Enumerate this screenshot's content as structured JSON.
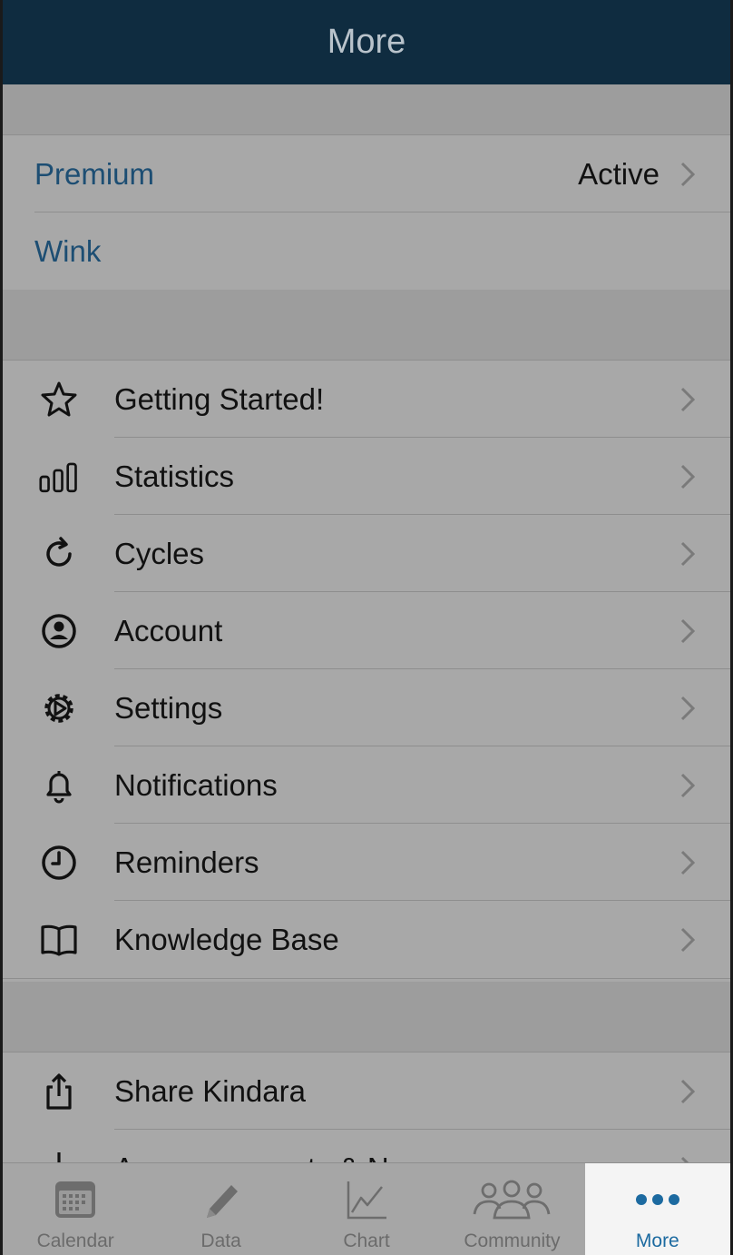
{
  "navbar": {
    "title": "More"
  },
  "premium_group": {
    "items": [
      {
        "label": "Premium",
        "value": "Active"
      },
      {
        "label": "Wink"
      }
    ]
  },
  "menu": {
    "items": [
      {
        "label": "Getting Started!",
        "icon": "star-icon"
      },
      {
        "label": "Statistics",
        "icon": "bar-chart-icon"
      },
      {
        "label": "Cycles",
        "icon": "refresh-icon"
      },
      {
        "label": "Account",
        "icon": "user-circle-icon"
      },
      {
        "label": "Settings",
        "icon": "gear-icon"
      },
      {
        "label": "Notifications",
        "icon": "bell-icon"
      },
      {
        "label": "Reminders",
        "icon": "clock-icon"
      },
      {
        "label": "Knowledge Base",
        "icon": "book-icon"
      }
    ]
  },
  "share_group": {
    "items": [
      {
        "label": "Share Kindara",
        "icon": "share-icon"
      },
      {
        "label": "Announcements & News",
        "icon": "download-icon"
      }
    ]
  },
  "tabbar": {
    "tabs": [
      {
        "label": "Calendar",
        "icon": "calendar-icon"
      },
      {
        "label": "Data",
        "icon": "pencil-icon"
      },
      {
        "label": "Chart",
        "icon": "line-chart-icon"
      },
      {
        "label": "Community",
        "icon": "people-icon"
      },
      {
        "label": "More",
        "icon": "more-dots-icon",
        "active": true
      }
    ]
  },
  "colors": {
    "navbar": "#0f2c40",
    "link": "#1d4e73",
    "active_tab": "#1c6aa0"
  }
}
